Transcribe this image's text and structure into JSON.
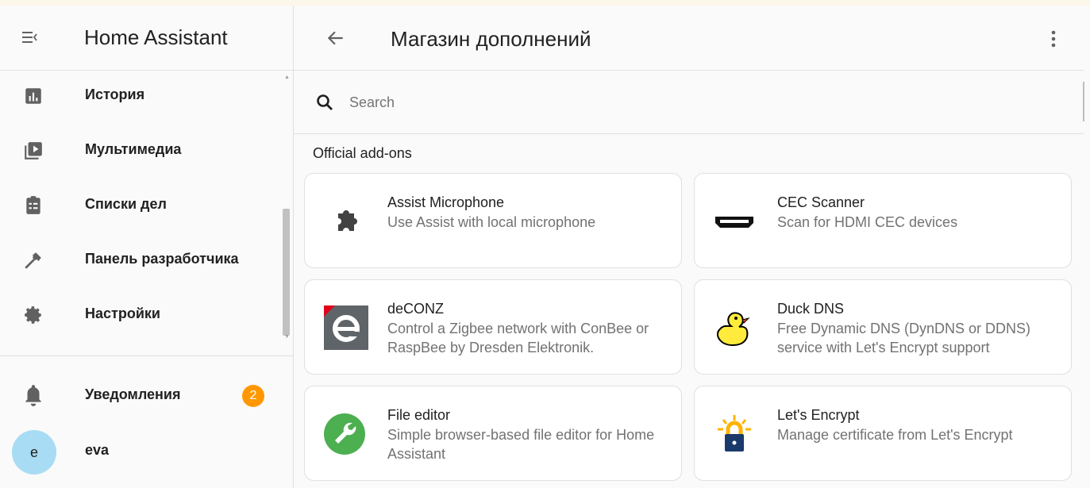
{
  "sidebar": {
    "title": "Home Assistant",
    "items": [
      {
        "label": "История",
        "icon": "history-chart-icon"
      },
      {
        "label": "Мультимедиа",
        "icon": "media-play-icon"
      },
      {
        "label": "Списки дел",
        "icon": "clipboard-list-icon"
      },
      {
        "label": "Панель разработчика",
        "icon": "hammer-icon"
      },
      {
        "label": "Настройки",
        "icon": "gear-icon"
      }
    ],
    "notifications": {
      "label": "Уведомления",
      "count": "2",
      "icon": "bell-icon"
    },
    "user": {
      "initial": "e",
      "name": "eva"
    }
  },
  "header": {
    "title": "Магазин дополнений"
  },
  "search": {
    "placeholder": "Search",
    "value": ""
  },
  "section": {
    "title": "Official add-ons"
  },
  "addons": [
    {
      "name": "Assist Microphone",
      "description": "Use Assist with local microphone",
      "icon": "puzzle-icon"
    },
    {
      "name": "CEC Scanner",
      "description": "Scan for HDMI CEC devices",
      "icon": "hdmi-icon"
    },
    {
      "name": "deCONZ",
      "description": "Control a Zigbee network with ConBee or RaspBee by Dresden Elektronik.",
      "icon": "deconz-logo-icon"
    },
    {
      "name": "Duck DNS",
      "description": "Free Dynamic DNS (DynDNS or DDNS) service with Let's Encrypt support",
      "icon": "duck-icon"
    },
    {
      "name": "File editor",
      "description": "Simple browser-based file editor for Home Assistant",
      "icon": "wrench-icon"
    },
    {
      "name": "Let's Encrypt",
      "description": "Manage certificate from Let's Encrypt",
      "icon": "padlock-icon"
    }
  ],
  "colors": {
    "badge": "#ff9800",
    "avatar": "#a8dcf4",
    "file_editor": "#4caf50",
    "lets_encrypt": "#ffb300"
  }
}
